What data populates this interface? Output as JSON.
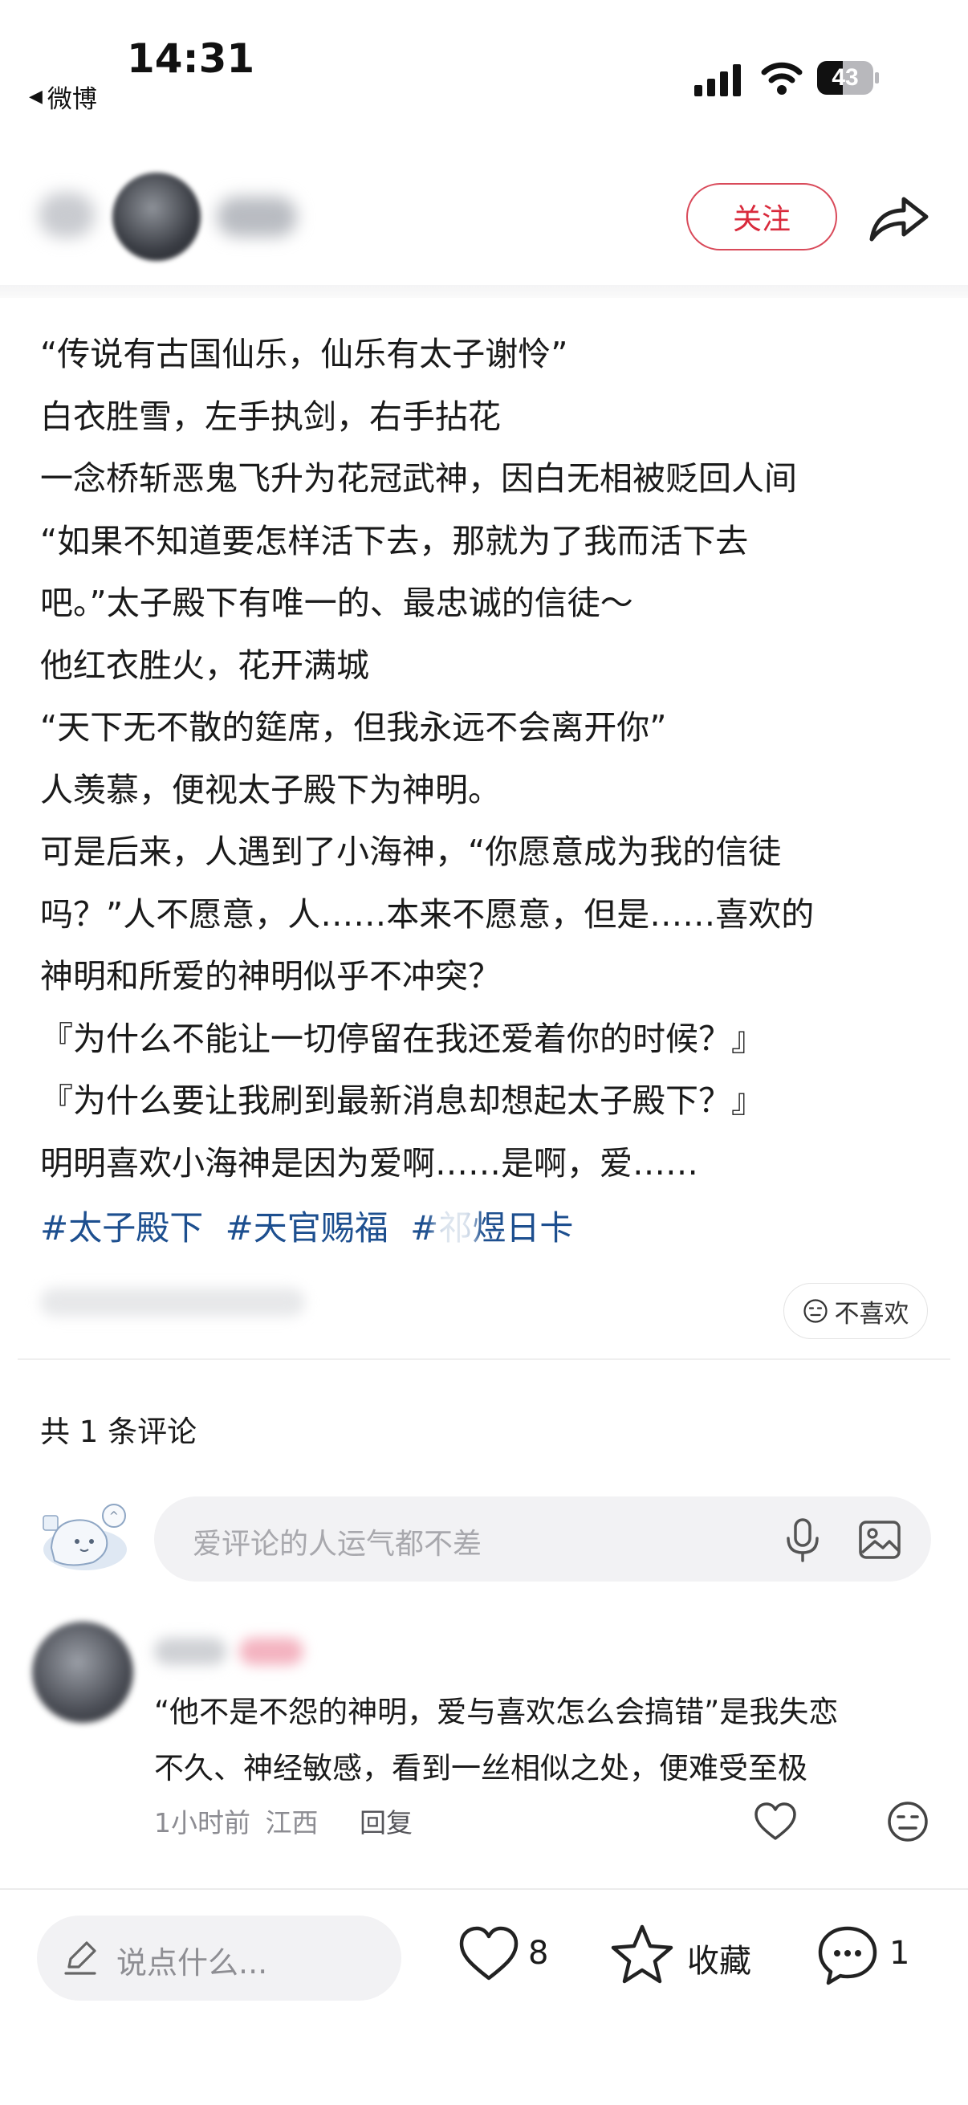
{
  "status_bar": {
    "time": "14:31",
    "back_app": "微博",
    "battery": "43"
  },
  "header": {
    "follow_label": "关注"
  },
  "post": {
    "lines": [
      "“传说有古国仙乐，仙乐有太子谢怜”",
      "白衣胜雪，左手执剑，右手拈花",
      "一念桥斩恶鬼飞升为花冠武神，因白无相被贬回人间",
      "“如果不知道要怎样活下去，那就为了我而活下去",
      "吧。”太子殿下有唯一的、最忠诚的信徒～",
      "他红衣胜火，花开满城",
      "“天下无不散的筵席，但我永远不会离开你”",
      "人羡慕，便视太子殿下为神明。",
      "可是后来，人遇到了小海神，“你愿意成为我的信徒",
      "吗？”人不愿意，人……本来不愿意，但是……喜欢的",
      "神明和所爱的神明似乎不冲突？",
      "『为什么不能让一切停留在我还爱着你的时候？』",
      "『为什么要让我刷到最新消息却想起太子殿下？』",
      "明明喜欢小海神是因为爱啊……是啊，爱……"
    ],
    "tags": [
      "#太子殿下",
      "#天官赐福",
      "#祁煜日卡"
    ],
    "dislike_label": "不喜欢"
  },
  "comments": {
    "count_label": "共 1 条评论",
    "input_placeholder": "爱评论的人运气都不差",
    "items": [
      {
        "text_lines": [
          "“他不是不怨的神明，爱与喜欢怎么会搞错”是我失恋",
          "不久、神经敏感，看到一丝相似之处，便难受至极"
        ],
        "time": "1小时前",
        "location": "江西",
        "reply_label": "回复"
      }
    ]
  },
  "bottom_bar": {
    "say_placeholder": "说点什么...",
    "like_count": "8",
    "favorite_label": "收藏",
    "comment_count": "1"
  },
  "colors": {
    "accent_red": "#d92a3c",
    "tag_blue": "#1d4f8f",
    "input_bg": "#f2f2f4"
  }
}
